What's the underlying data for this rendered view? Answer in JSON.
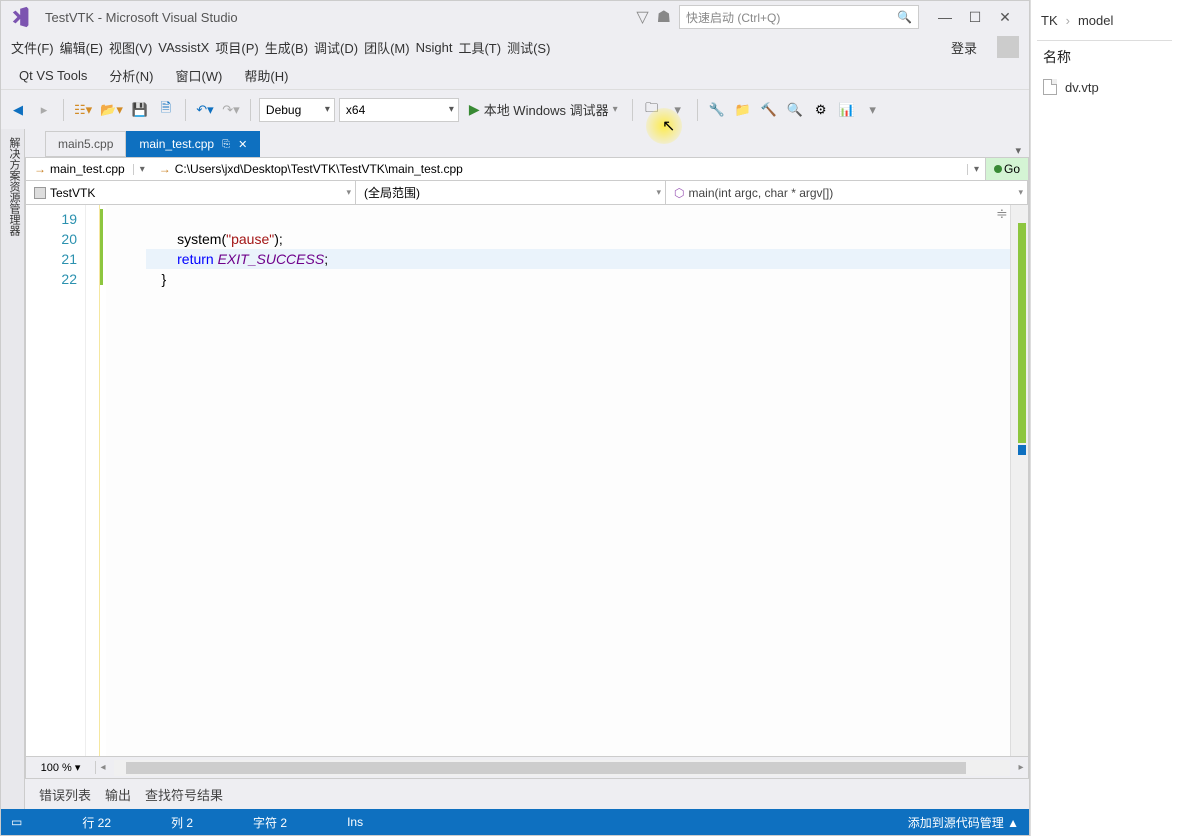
{
  "title": "TestVTK - Microsoft Visual Studio",
  "quick_launch_placeholder": "快速启动 (Ctrl+Q)",
  "menu": {
    "file": "文件(F)",
    "edit": "编辑(E)",
    "view": "视图(V)",
    "vassistx": "VAssistX",
    "project": "项目(P)",
    "build": "生成(B)",
    "debug": "调试(D)",
    "team": "团队(M)",
    "nsight": "Nsight",
    "tools": "工具(T)",
    "test": "测试(S)",
    "qt": "Qt VS Tools",
    "analyze": "分析(N)",
    "window": "窗口(W)",
    "help": "帮助(H)",
    "login": "登录"
  },
  "toolbar": {
    "config": "Debug",
    "platform": "x64",
    "run_label": "本地 Windows 调试器"
  },
  "tabs": [
    {
      "label": "main5.cpp",
      "active": false
    },
    {
      "label": "main_test.cpp",
      "active": true
    }
  ],
  "pathbar": {
    "file": "main_test.cpp",
    "fullpath": "C:\\Users\\jxd\\Desktop\\TestVTK\\TestVTK\\main_test.cpp",
    "go": "Go"
  },
  "navbar": {
    "scope1": "TestVTK",
    "scope2": "(全局范围)",
    "scope3": "main(int argc, char * argv[])"
  },
  "code": {
    "lines": [
      "19",
      "20",
      "21",
      "22"
    ],
    "l19": "",
    "l20_indent": "        ",
    "l20_fn": "system",
    "l20_paren": "(",
    "l20_str": "\"pause\"",
    "l20_end": ");",
    "l21_indent": "        ",
    "l21_kw": "return",
    "l21_sp": " ",
    "l21_mac": "EXIT_SUCCESS",
    "l21_end": ";",
    "l22": "    }"
  },
  "zoom": "100 %",
  "output_tabs": {
    "errors": "错误列表",
    "output": "输出",
    "findsym": "查找符号结果"
  },
  "status": {
    "line": "行 22",
    "col": "列 2",
    "char": "字符 2",
    "ins": "Ins",
    "scm": "添加到源代码管理 ▲"
  },
  "side_tool": "解决方案资源管理器",
  "right": {
    "crumb1": "TK",
    "crumb2": "model",
    "header": "名称",
    "file": "dv.vtp"
  }
}
